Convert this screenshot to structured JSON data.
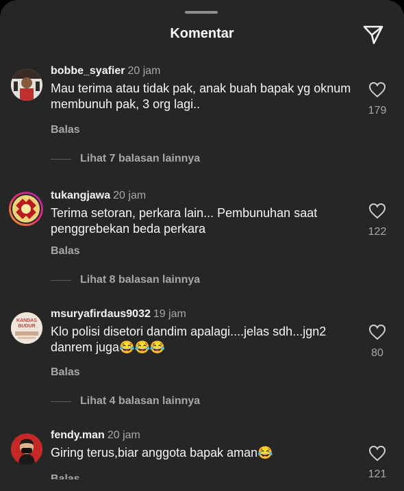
{
  "header": {
    "title": "Komentar",
    "share_icon": "send-icon"
  },
  "comments": [
    {
      "username": "bobbe_syafier",
      "time": "20 jam",
      "text": "Mau terima atau tidak pak, anak buah bapak yg oknum membunuh pak, 3 org lagi..",
      "likes": "179",
      "reply_label": "Balas",
      "view_replies": "Lihat 7 balasan lainnya"
    },
    {
      "username": "tukangjawa",
      "time": "20 jam",
      "text": "Terima setoran, perkara lain... Pembunuhan saat penggrebekan beda perkara",
      "likes": "122",
      "reply_label": "Balas",
      "view_replies": "Lihat 8 balasan lainnya"
    },
    {
      "username": "msuryafirdaus9032",
      "time": "19 jam",
      "text": "Klo polisi disetori dandim apalagi....jelas sdh...jgn2 danrem juga😂😂😂",
      "likes": "80",
      "reply_label": "Balas",
      "view_replies": "Lihat 4 balasan lainnya",
      "avatar_text": "KANDAS BUDUR"
    },
    {
      "username": "fendy.man",
      "time": "20 jam",
      "text": "Giring terus,biar anggota bapak aman😂",
      "likes": "121",
      "reply_label": "Balas"
    }
  ],
  "colors": {
    "background": "#262626",
    "text": "#f5f5f5",
    "muted": "#a8a8a8"
  }
}
